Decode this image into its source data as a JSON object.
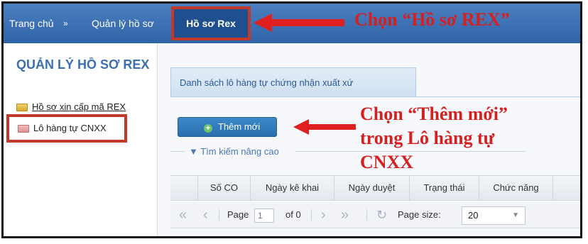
{
  "nav": {
    "home": "Trang chủ",
    "separator": "»",
    "ql_hoso": "Quản lý hồ sơ",
    "hoso_rex": "Hồ sơ Rex"
  },
  "annotations": {
    "callout_top": "Chọn “Hồ sơ REX”",
    "callout_main_lines": [
      "Chọn “Thêm mới”",
      "trong Lô hàng tự",
      "CNXX"
    ],
    "highlight_color": "#c0392b",
    "callout_color": "#d62020"
  },
  "sidebar": {
    "title": "QUẢN LÝ HỒ SƠ REX",
    "items": [
      {
        "label": "Hồ sơ xin cấp mã REX",
        "icon": "folder-icon"
      },
      {
        "label": "Lô hàng tự CNXX",
        "icon": "folder-icon"
      }
    ]
  },
  "main": {
    "tab_label": "Danh sách lô hàng tự chứng nhận xuất xứ",
    "add_button": "Thêm mới",
    "advanced_search": "Tìm kiếm nâng cao",
    "table_headers": [
      "Số CO",
      "Ngày kê khai",
      "Ngày duyệt",
      "Trạng thái",
      "Chức năng"
    ],
    "pager": {
      "page_label": "Page",
      "page_value": "1",
      "of_label": "of 0",
      "page_size_label": "Page size:",
      "page_size_value": "20"
    }
  },
  "colors": {
    "nav_bar": "#2f64a8",
    "accent_blue": "#3b6fae"
  }
}
